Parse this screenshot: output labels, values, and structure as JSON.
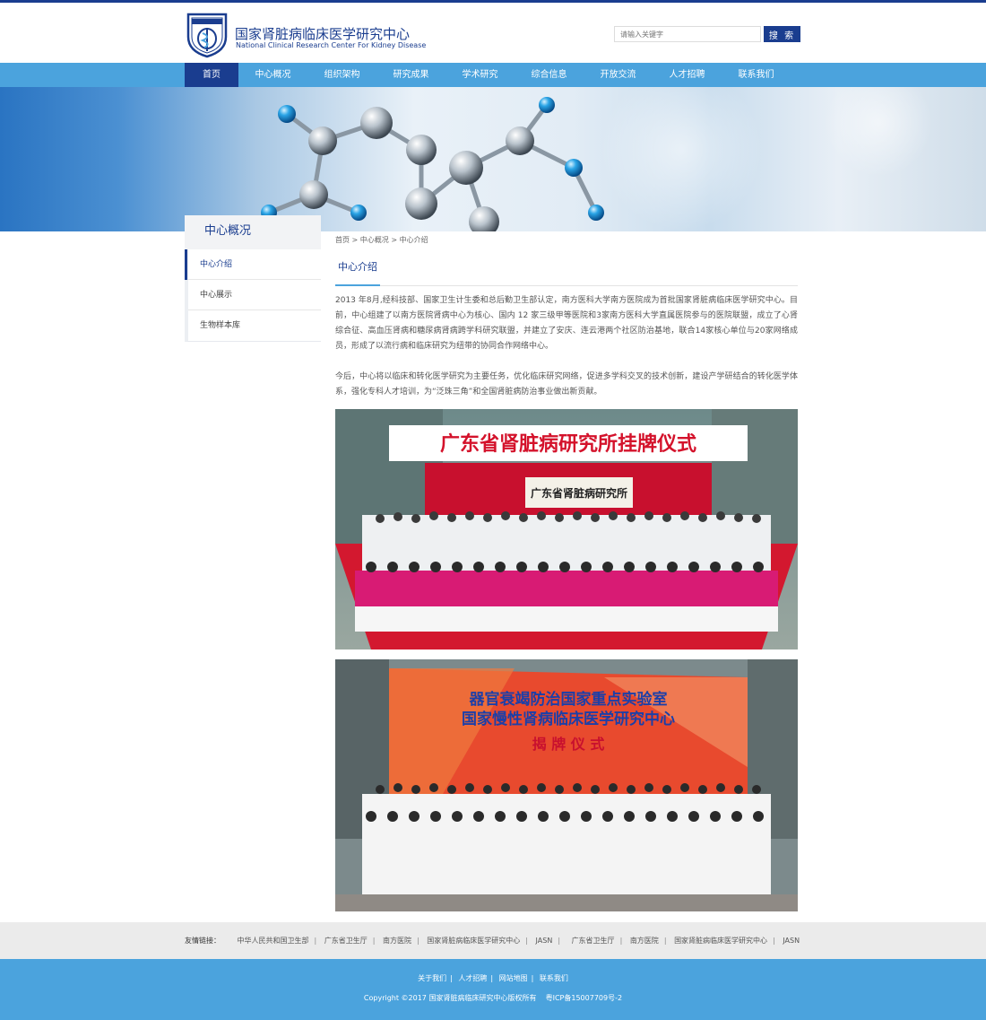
{
  "header": {
    "title_cn": "国家肾脏病临床医学研究中心",
    "title_en": "National Clinical Research Center For Kidney Disease",
    "search_placeholder": "请输入关键字",
    "search_button": "搜 索"
  },
  "nav": {
    "items": [
      "首页",
      "中心概况",
      "组织架构",
      "研究成果",
      "学术研究",
      "综合信息",
      "开放交流",
      "人才招聘",
      "联系我们"
    ],
    "active_index": 0
  },
  "sidebar": {
    "title": "中心概况",
    "items": [
      "中心介绍",
      "中心展示",
      "生物样本库"
    ],
    "active_index": 0
  },
  "breadcrumb": "首页 > 中心概况 > 中心介绍",
  "section_title": "中心介绍",
  "paragraphs": [
    "2013 年8月,经科技部、国家卫生计生委和总后勤卫生部认定，南方医科大学南方医院成为首批国家肾脏病临床医学研究中心。目前，中心组建了以南方医院肾病中心为核心、国内 12 家三级甲等医院和3家南方医科大学直属医院参与的医院联盟，成立了心肾综合征、高血压肾病和糖尿病肾病跨学科研究联盟，并建立了安庆、连云港两个社区防治基地，联合14家核心单位与20家网络成员，形成了以流行病和临床研究为纽带的协同合作网络中心。",
    "今后，中心将以临床和转化医学研究为主要任务，优化临床研究网络，促进多学科交叉的技术创新，建设产学研结合的转化医学体系，强化专科人才培训，为“泛珠三角”和全国肾脏病防治事业做出新贡献。"
  ],
  "photos": [
    {
      "banner_text": "广东省肾脏病研究所挂牌仪式",
      "plaque_text": "广东省肾脏病研究所"
    },
    {
      "line1": "器官衰竭防治国家重点实验室",
      "line2": "国家慢性肾病临床医学研究中心",
      "line3": "揭 牌 仪 式"
    }
  ],
  "friend_links": {
    "label": "友情链接：",
    "items": [
      "中华人民共和国卫生部",
      "广东省卫生厅",
      "南方医院",
      "国家肾脏病临床医学研究中心",
      "JASN",
      "广东省卫生厅",
      "南方医院",
      "国家肾脏病临床医学研究中心",
      "JASN"
    ]
  },
  "footer": {
    "links": [
      "关于我们",
      "人才招聘",
      "网站地图",
      "联系我们"
    ],
    "copyright": "Copyright ©2017 国家肾脏病临床研究中心版权所有    粤ICP备15007709号-2"
  },
  "colors": {
    "primary": "#1a3d8f",
    "accent": "#4ba3dd",
    "gray_bar": "#ebebeb"
  }
}
